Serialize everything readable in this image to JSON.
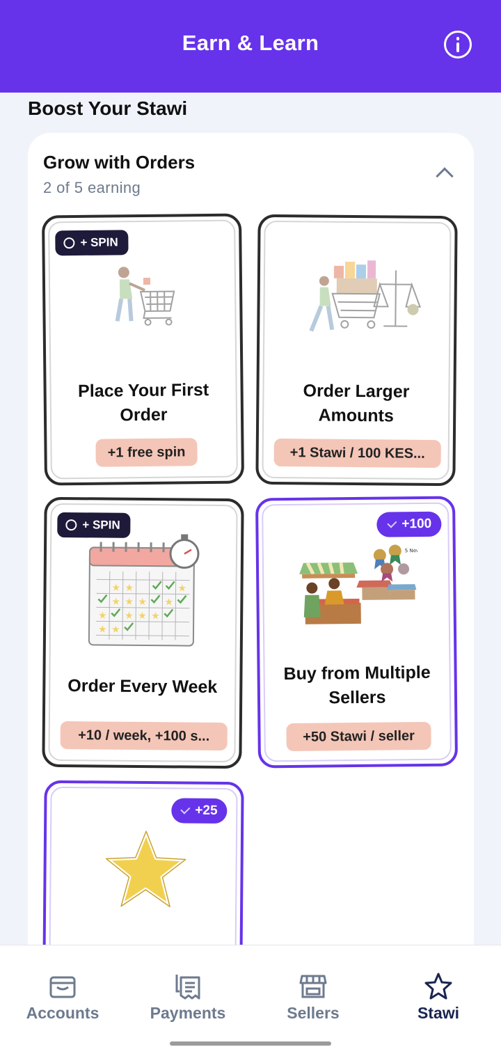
{
  "header": {
    "title": "Earn & Learn",
    "info_icon": "info-icon"
  },
  "section": {
    "title": "Boost Your Stawi"
  },
  "panel": {
    "title": "Grow with Orders",
    "subtitle": "2 of 5 earning",
    "collapse_icon": "chevron-up-icon"
  },
  "cards": [
    {
      "title_lines": [
        "Place Your First",
        "Order"
      ],
      "reward": "+1 free spin",
      "badge": "+ SPIN",
      "badge_type": "spin",
      "status": "earning",
      "illustration": "shopping-cart-illustration"
    },
    {
      "title_lines": [
        "Order Larger",
        "Amounts"
      ],
      "reward": "+1 Stawi / 100 KES...",
      "badge": "",
      "badge_type": "none",
      "status": "earning",
      "illustration": "cart-scale-illustration"
    },
    {
      "title_lines": [
        "Order Every Week"
      ],
      "reward": "+10 / week, +100 s...",
      "badge": "+ SPIN",
      "badge_type": "spin",
      "status": "earning",
      "illustration": "calendar-stopwatch-illustration"
    },
    {
      "title_lines": [
        "Buy from Multiple",
        "Sellers"
      ],
      "reward": "+50 Stawi / seller",
      "badge": "+100",
      "badge_type": "check",
      "status": "completed",
      "illustration": "market-stalls-illustration",
      "illustration_text": "5 New"
    },
    {
      "title_lines": [],
      "reward": "",
      "badge": "+25",
      "badge_type": "check",
      "status": "completed",
      "illustration": "star-illustration"
    }
  ],
  "bottom_nav": [
    {
      "label": "Accounts",
      "icon": "wallet-icon",
      "active": false
    },
    {
      "label": "Payments",
      "icon": "receipt-icon",
      "active": false
    },
    {
      "label": "Sellers",
      "icon": "store-icon",
      "active": false
    },
    {
      "label": "Stawi",
      "icon": "star-icon",
      "active": true
    }
  ],
  "colors": {
    "brand": "#6633ea",
    "badge_dark": "#1e1a3a",
    "reward_bg": "#f4c6b8",
    "nav_active": "#1a2550",
    "nav_inactive": "#6d7a8e"
  }
}
